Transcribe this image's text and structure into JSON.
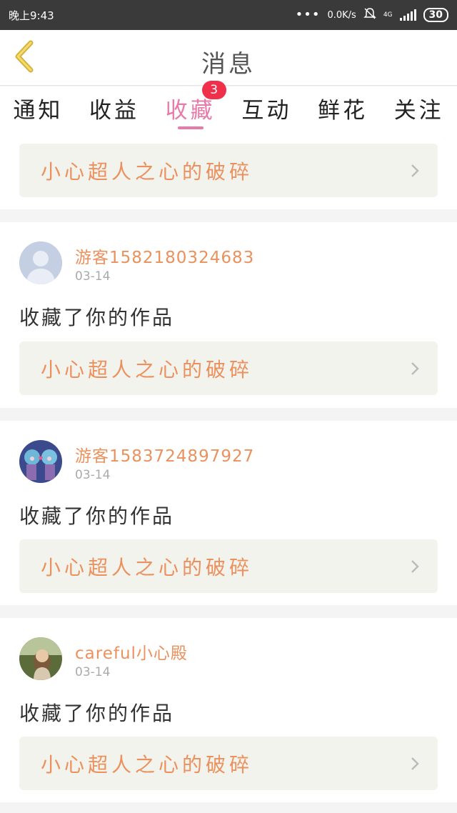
{
  "status_bar": {
    "time": "晚上9:43",
    "network_speed": "0.0K/s",
    "network_type": "4G",
    "battery": "30"
  },
  "header": {
    "title": "消息",
    "back_icon": "chevron-left-icon"
  },
  "tabs": [
    {
      "label": "通知",
      "active": false
    },
    {
      "label": "收益",
      "active": false
    },
    {
      "label": "收藏",
      "active": true,
      "badge": "3"
    },
    {
      "label": "互动",
      "active": false
    },
    {
      "label": "鲜花",
      "active": false
    },
    {
      "label": "关注",
      "active": false
    }
  ],
  "top_work": {
    "title": "小心超人之心的破碎"
  },
  "items": [
    {
      "username": "游客1582180324683",
      "date": "03-14",
      "action": "收藏了你的作品",
      "work_title": "小心超人之心的破碎",
      "avatar": "default-avatar"
    },
    {
      "username": "游客1583724897927",
      "date": "03-14",
      "action": "收藏了你的作品",
      "work_title": "小心超人之心的破碎",
      "avatar": "anime-avatar"
    },
    {
      "username": "careful小心殿",
      "date": "03-14",
      "action": "收藏了你的作品",
      "work_title": "小心超人之心的破碎",
      "avatar": "photo-avatar"
    }
  ],
  "colors": {
    "accent_pink": "#e77aa8",
    "orange_text": "#eb915d",
    "badge_red": "#f0304a"
  }
}
